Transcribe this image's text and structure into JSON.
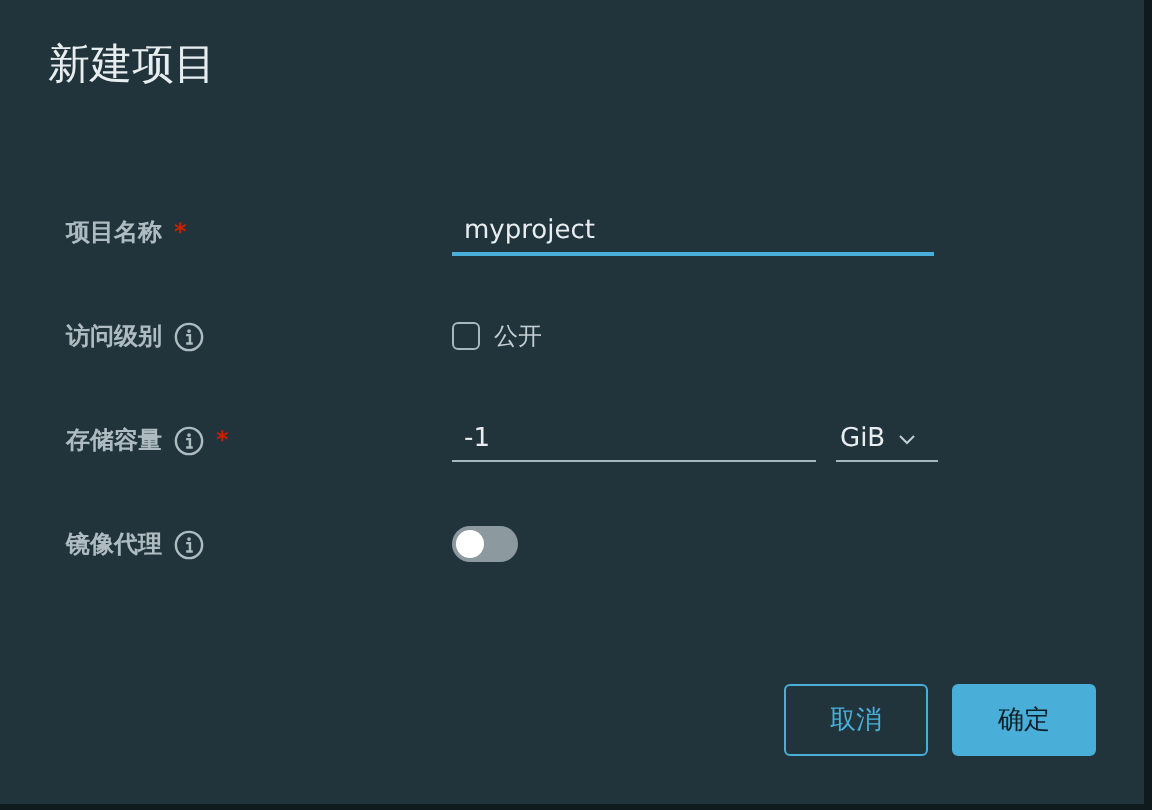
{
  "dialog": {
    "title": "新建项目"
  },
  "fields": [
    {
      "kind": "text",
      "label": "项目名称",
      "required_mark": "*",
      "info": false,
      "value": "myproject",
      "focused": true
    },
    {
      "kind": "checkbox",
      "label": "访问级别",
      "info": true,
      "option": "公开",
      "checked": false
    },
    {
      "kind": "quota",
      "label": "存储容量",
      "info": true,
      "required_mark": "*",
      "value": "-1",
      "unit": "GiB",
      "focused": false
    },
    {
      "kind": "toggle",
      "label": "镜像代理",
      "info": true,
      "on": false
    }
  ],
  "buttons": [
    {
      "label": "取消",
      "kind": "secondary"
    },
    {
      "label": "确定",
      "kind": "primary"
    }
  ]
}
